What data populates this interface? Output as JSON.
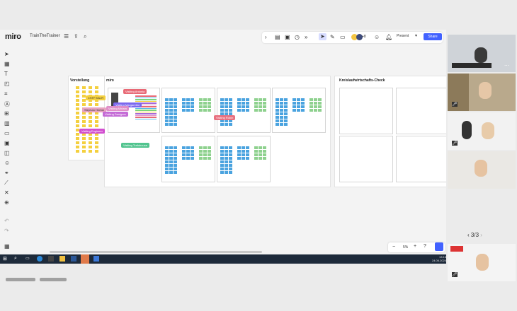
{
  "app": {
    "logo": "miro",
    "board_name": "TrainTheTrainer"
  },
  "toolbar": {
    "present_label": "Present",
    "share_label": "Share",
    "participant_count": "+8"
  },
  "frames": {
    "vorstellung_title": "Vorstellung",
    "miro_title": "miro",
    "kreislauf_title": "Kreislaufwirtschafts-Check"
  },
  "tags": [
    {
      "label": "Visiting Antonia",
      "color": "#e86a76"
    },
    {
      "label": "CSTF Mia R",
      "color": "#f4d03f"
    },
    {
      "label": "Visiting Margarethe",
      "color": "#7b68ee"
    },
    {
      "label": "Stephan Herbst",
      "color": "#e8a3c0"
    },
    {
      "label": "Visiting Miriam",
      "color": "#e08fc8"
    },
    {
      "label": "Visiting Daniel",
      "color": "#a668d8"
    },
    {
      "label": "Visiting Designer",
      "color": "#c46bd6"
    },
    {
      "label": "Visiting Engineer",
      "color": "#d24fd0"
    },
    {
      "label": "Visiting Robin",
      "color": "#e8707f"
    },
    {
      "label": "Visiting Trafohouse",
      "color": "#52c48f"
    }
  ],
  "zoom": {
    "level": "5%"
  },
  "pager": {
    "text": "3/3"
  },
  "taskbar": {
    "time": "13:16",
    "date": "24.06.2024"
  }
}
